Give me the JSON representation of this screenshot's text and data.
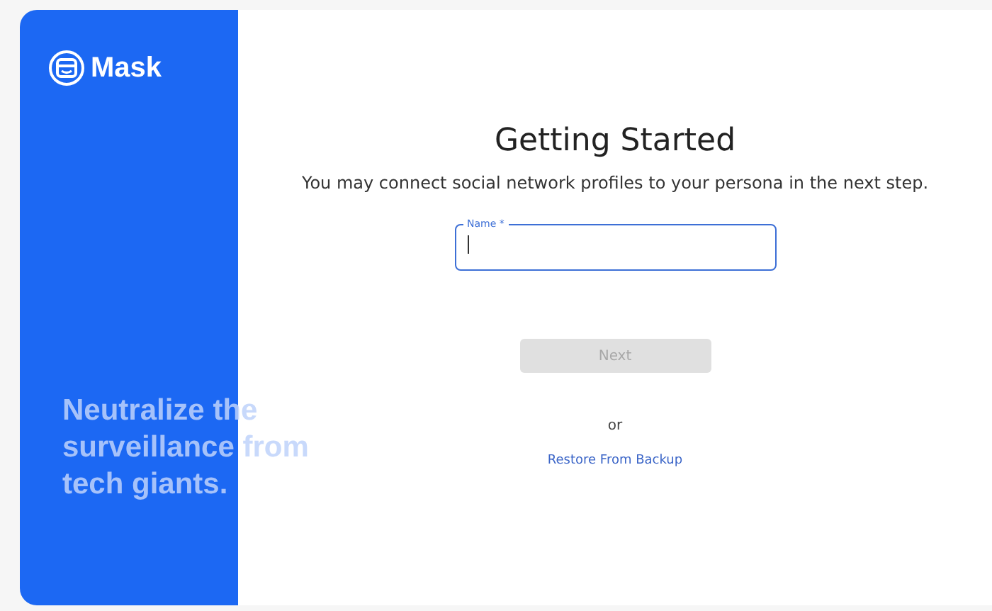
{
  "sidebar": {
    "brand": "Mask",
    "tagline": "Neutralize the surveillance from tech giants."
  },
  "main": {
    "title": "Getting Started",
    "subtitle": "You may connect social network profiles to your persona in the next step.",
    "name_field": {
      "label": "Name *",
      "focused": true
    },
    "next_button": {
      "label": "Next",
      "disabled": true
    },
    "separator": "or",
    "restore_link": "Restore From Backup"
  }
}
